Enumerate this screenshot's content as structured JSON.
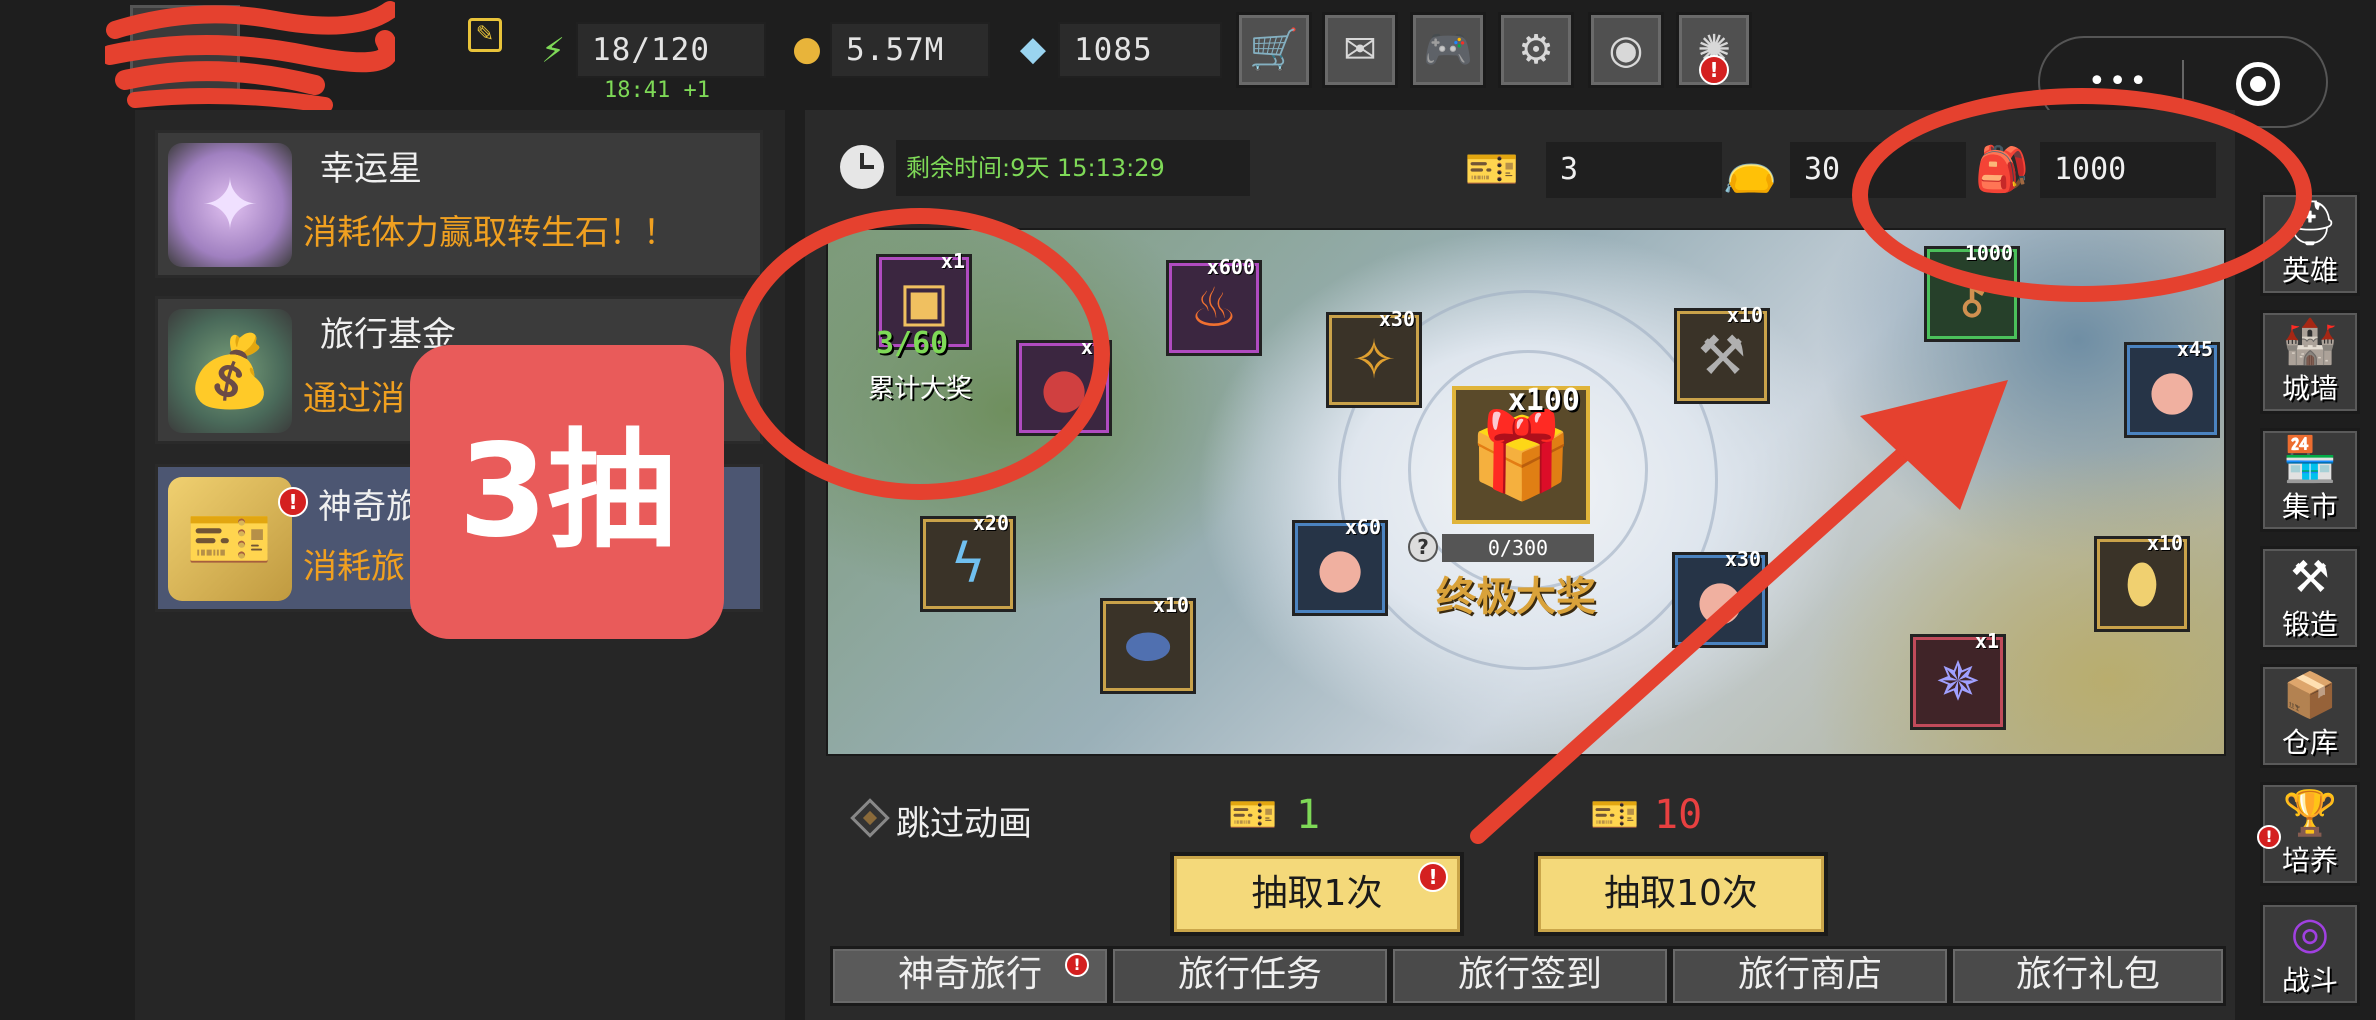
{
  "header": {
    "stamina": "18/120",
    "stamina_regen": "18:41 +1",
    "gold": "5.57M",
    "gems": "1085",
    "toolbar_icons": [
      "cart-icon",
      "mail-icon",
      "gamepad-icon",
      "gear-icon",
      "aperture-icon",
      "fireworks-icon"
    ]
  },
  "sidebar_left": {
    "cards": [
      {
        "title": "幸运星",
        "desc": "消耗体力赢取转生石！！"
      },
      {
        "title": "旅行基金",
        "desc": "通过消"
      },
      {
        "title": "神奇旅",
        "desc": "消耗旅"
      }
    ]
  },
  "annotation": {
    "label": "3抽"
  },
  "event": {
    "time_remaining": "剩余时间:9天 15:13:29",
    "ticket_count": "3",
    "bag_count": "30",
    "red_bag_count": "1000"
  },
  "map": {
    "cumulative_progress": "3/60",
    "cumulative_label": "累计大奖",
    "grand_qty": "x100",
    "grand_progress": "0/300",
    "grand_label": "终极大奖",
    "rewards": [
      {
        "qty": "x1",
        "icon": "chest-icon"
      },
      {
        "qty": "x1",
        "icon": "red-bag-icon"
      },
      {
        "qty": "x600",
        "icon": "fire-icon"
      },
      {
        "qty": "x30",
        "icon": "crystal-shard-icon"
      },
      {
        "qty": "x10",
        "icon": "hammer-icon"
      },
      {
        "qty": "1000",
        "icon": "key-icon"
      },
      {
        "qty": "x45",
        "icon": "pouch-icon"
      },
      {
        "qty": "x20",
        "icon": "lightning-icon"
      },
      {
        "qty": "x10",
        "icon": "stone-icon"
      },
      {
        "qty": "x60",
        "icon": "pouch-icon"
      },
      {
        "qty": "x30",
        "icon": "pouch-icon"
      },
      {
        "qty": "x10",
        "icon": "egg-icon"
      },
      {
        "qty": "x1",
        "icon": "gem-icon"
      }
    ]
  },
  "controls": {
    "skip_animation": "跳过动画",
    "cost_single": "1",
    "cost_ten": "10",
    "draw_single": "抽取1次",
    "draw_ten": "抽取10次"
  },
  "tabs": [
    "神奇旅行",
    "旅行任务",
    "旅行签到",
    "旅行商店",
    "旅行礼包"
  ],
  "side_nav": [
    "英雄",
    "城墙",
    "集市",
    "锻造",
    "仓库",
    "培养",
    "战斗"
  ],
  "colors": {
    "annotation_red": "#e5412f",
    "overlay_badge": "#e95b5a",
    "accent_orange": "#f0a020",
    "timer_green": "#7ed957",
    "draw_button": "#f4d97a"
  }
}
